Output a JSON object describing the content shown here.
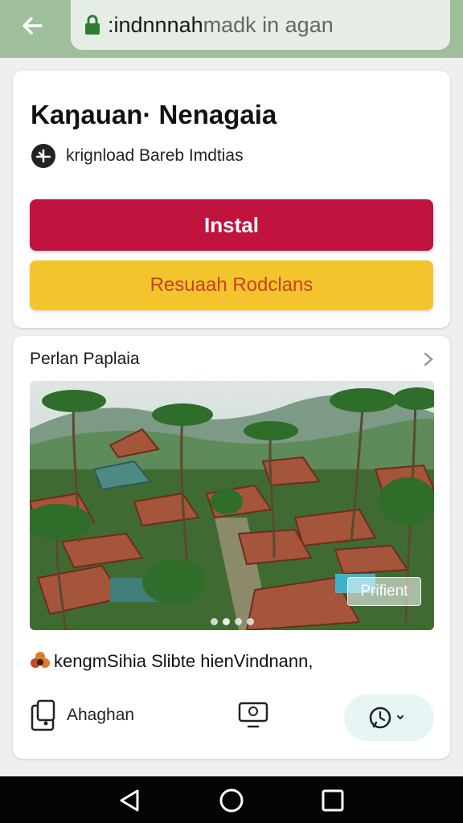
{
  "browser": {
    "url_prefix": ":indnnnah",
    "url_rest": "madk in agan"
  },
  "app": {
    "title": "Kaŋauan· Nenagaia",
    "subtitle": "krignload Bareb Imdtias",
    "install_label": "Instal",
    "secondary_label": "Resuaah Rodclans"
  },
  "gallery": {
    "section_title": "Perlan Paplaia",
    "preview_label": "Prifient",
    "description": "kengmSihia Slibte hienVindnann,",
    "slides": 4,
    "active_slide": 2
  },
  "actions": {
    "item_a_label": "Ahaghan"
  },
  "icons": [
    "back-arrow-icon",
    "lock-icon",
    "download-icon",
    "chevron-right-icon",
    "device-icon",
    "monitor-icon",
    "chat-icon",
    "nav-back-icon",
    "nav-home-icon",
    "nav-recents-icon"
  ],
  "colors": {
    "topbar": "#9ebf9a",
    "install": "#c0143e",
    "secondary": "#f4c42c",
    "secondary_text": "#c8402a"
  }
}
